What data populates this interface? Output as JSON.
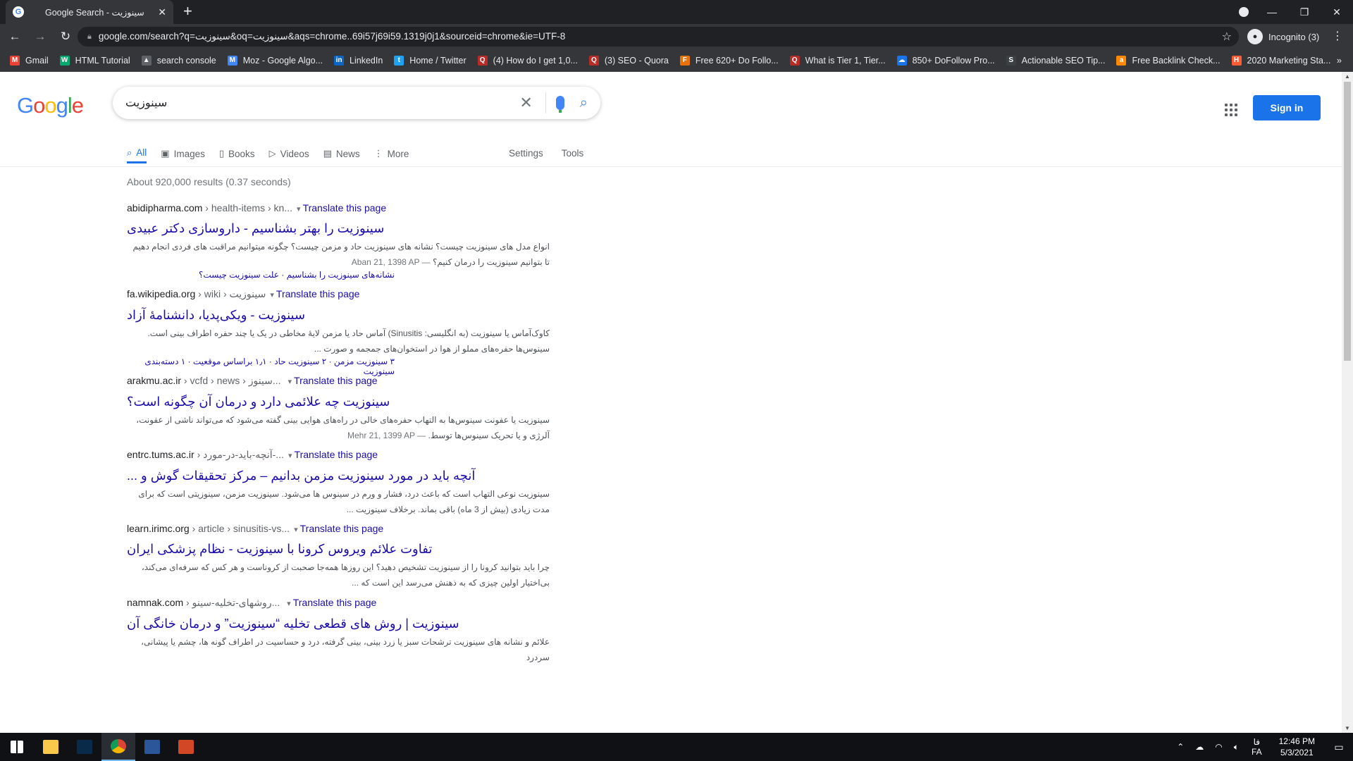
{
  "browser": {
    "tab_title": "Google Search - سینوزیت",
    "tab_favicon": "G",
    "new_tab": "+",
    "close_tab": "✕",
    "url": "google.com/search?q=سینوزیت&oq=سینوزیت&aqs=chrome..69i57j69i59.1319j0j1&sourceid=chrome&ie=UTF-8",
    "profile_label": "Incognito (3)",
    "window_controls": [
      "—",
      "❐",
      "✕"
    ],
    "bookmarks": [
      {
        "label": "Gmail",
        "icon": "gmail-icon",
        "color": "#ea4335",
        "glyph": "M"
      },
      {
        "label": "HTML Tutorial",
        "icon": "w3-icon",
        "color": "#04aa6d",
        "glyph": "W"
      },
      {
        "label": "search console",
        "icon": "search-console-icon",
        "color": "#5f6368",
        "glyph": "▲"
      },
      {
        "label": "Moz - Google Algo...",
        "icon": "moz-icon",
        "color": "#4285f4",
        "glyph": "M"
      },
      {
        "label": "LinkedIn",
        "icon": "linkedin-icon",
        "color": "#0a66c2",
        "glyph": "in"
      },
      {
        "label": "Home / Twitter",
        "icon": "twitter-icon",
        "color": "#1da1f2",
        "glyph": "t"
      },
      {
        "label": "(4) How do I get 1,0...",
        "icon": "quora-icon",
        "color": "#b92b27",
        "glyph": "Q"
      },
      {
        "label": "(3) SEO - Quora",
        "icon": "quora-icon",
        "color": "#b92b27",
        "glyph": "Q"
      },
      {
        "label": "Free 620+ Do Follo...",
        "icon": "site-icon",
        "color": "#e8710a",
        "glyph": "F"
      },
      {
        "label": "What is Tier 1, Tier...",
        "icon": "quora-icon",
        "color": "#b92b27",
        "glyph": "Q"
      },
      {
        "label": "850+ DoFollow Pro...",
        "icon": "cloud-icon",
        "color": "#1a73e8",
        "glyph": "☁"
      },
      {
        "label": "Actionable SEO Tip...",
        "icon": "seo-icon",
        "color": "#3c4043",
        "glyph": "S"
      },
      {
        "label": "Free Backlink Check...",
        "icon": "ahrefs-icon",
        "color": "#ff8800",
        "glyph": "a"
      },
      {
        "label": "2020 Marketing Sta...",
        "icon": "hubspot-icon",
        "color": "#ff5c35",
        "glyph": "H"
      }
    ],
    "bookmarks_more": "»"
  },
  "google": {
    "logo_letters": [
      "G",
      "o",
      "o",
      "g",
      "l",
      "e"
    ],
    "query": "سینوزیت",
    "sign_in": "Sign in",
    "tabs": [
      {
        "label": "All",
        "icon": "search-icon",
        "glyph": "⌕",
        "active": true
      },
      {
        "label": "Images",
        "icon": "image-icon",
        "glyph": "▣"
      },
      {
        "label": "Books",
        "icon": "book-icon",
        "glyph": "▯"
      },
      {
        "label": "Videos",
        "icon": "video-icon",
        "glyph": "▷"
      },
      {
        "label": "News",
        "icon": "news-icon",
        "glyph": "▤"
      },
      {
        "label": "More",
        "icon": "more-icon",
        "glyph": "⋮"
      }
    ],
    "settings": "Settings",
    "tools": "Tools",
    "stats": "About 920,000 results (0.37 seconds)",
    "results": [
      {
        "domain": "abidipharma.com",
        "path": " › health-items › kn...",
        "translate": "Translate this page",
        "title": "سینوزیت را بهتر بشناسیم - داروسازی دکتر عبیدی",
        "date": "Aban 21, 1398 AP —",
        "snippet": "انواع مدل های سینوزیت چیست؟ نشانه های سینوزیت حاد و مزمن چیست؟ چگونه میتوانیم مراقبت های فردی انجام دهیم تا بتوانیم سینوزیت را درمان کنیم؟",
        "sublinks": "نشانه‌های سینوزیت را بشناسیم · علت سینوزیت چیست؟"
      },
      {
        "domain": "fa.wikipedia.org",
        "path": " › wiki › سینوزیت",
        "translate": "Translate this page",
        "title": "سینوزیت - ویکی‌پدیا، دانشنامهٔ آزاد",
        "date": "",
        "snippet": "کاوک‌آماس یا سینوزیت (به انگلیسی: Sinusitis) آماس حاد یا مزمن لایهٔ مخاطی در یک یا چند حفره اطراف بینی است. سینوس‌ها حفره‌های مملو از هوا در استخوان‌های جمجمه و صورت ...",
        "sublinks": "۳ سینوزیت مزمن · ۲ سینوزیت حاد · ۱٫۱ براساس موقعیت · ۱ دسته‌بندی سینوزیت"
      },
      {
        "domain": "arakmu.ac.ir",
        "path": " › vcfd › news › سینوز... ",
        "translate": "Translate this page",
        "title": "سینوزیت چه علائمی دارد و درمان آن چگونه است؟",
        "date": "Mehr 21, 1399 AP —",
        "snippet": "سینوزیت یا عفونت سینوس‌ها به التهاب حفره‌های خالی در راه‌های هوایی بینی گفته می‌شود که می‌تواند ناشی از عفونت، آلرژی و یا تحریک سینوس‌ها توسط.",
        "sublinks": ""
      },
      {
        "domain": "entrc.tums.ac.ir",
        "path": " › آنچه-باید-در-مورد-...",
        "translate": "Translate this page",
        "title": "آنچه باید در مورد سینوزیت مزمن بدانیم – مرکز تحقیقات گوش و ...",
        "date": "",
        "snippet": "سینوزیت نوعی التهاب است که باعث درد، فشار و ورم در سینوس ها می‌شود. سینوزیت مزمن، سینوزیتی است که برای مدت زیادی (بیش از 3 ماه) باقی بماند. برخلاف سینوزیت ...",
        "sublinks": ""
      },
      {
        "domain": "learn.irimc.org",
        "path": " › article › sinusitis-vs...",
        "translate": "Translate this page",
        "title": "تفاوت علائم ویروس کرونا با سینوزیت - نظام پزشکی ایران",
        "date": "",
        "snippet": "چرا باید بتوانید کرونا را از سینوزیت تشخیص دهید؟ این روزها همه‌جا صحبت از کروناست و هر کس که سرفه‌ای می‌کند، بی‌اختیار اولین چیزی که به ذهنش می‌رسد این است که ...",
        "sublinks": ""
      },
      {
        "domain": "namnak.com",
        "path": " › روشهای-تخلیه-سینو... ",
        "translate": "Translate this page",
        "title": "سینوزیت | روش های قطعی تخلیه “سینوزیت” و درمان خانگی آن",
        "date": "",
        "snippet": "علائم و نشانه های سینوزیت ترشحات سبز یا زرد بینی، بینی گرفته، درد و حساسیت در اطراف گونه ها، چشم یا پیشانی، سردرد",
        "sublinks": ""
      }
    ]
  },
  "taskbar": {
    "apps": [
      {
        "name": "start-button",
        "color": "#ffffff"
      },
      {
        "name": "file-explorer-icon",
        "color": "#f8c94a"
      },
      {
        "name": "photoshop-icon",
        "color": "#0a2a4a"
      },
      {
        "name": "chrome-icon",
        "color": "#db4437",
        "active": true
      },
      {
        "name": "word-icon",
        "color": "#2b579a"
      },
      {
        "name": "powerpoint-icon",
        "color": "#d24726"
      }
    ],
    "lang_top": "فا",
    "lang_bottom": "FA",
    "time": "12:46 PM",
    "date": "5/3/2021"
  }
}
